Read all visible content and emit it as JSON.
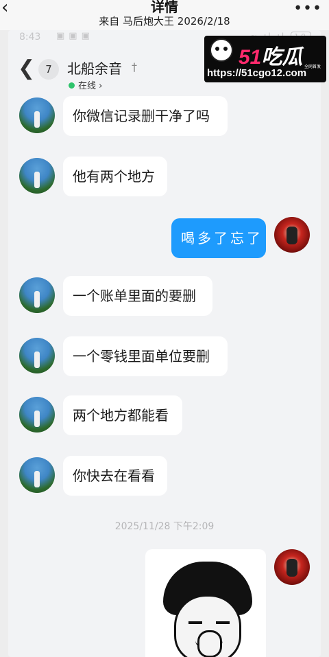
{
  "outer": {
    "back_icon": "chevron-left-icon",
    "title": "详情",
    "subtitle": "来自 马后炮大王 2026/2/18",
    "more_icon": "more-dots-icon"
  },
  "statusbar": {
    "time": "8:43",
    "battery": "10"
  },
  "chat": {
    "unread_count": "7",
    "contact_name": "北船余音",
    "status": "在线 ›"
  },
  "watermark": {
    "brand_num": "51",
    "brand_text": "吃瓜",
    "tag": "全网首发",
    "url": "https://51cgo12.com"
  },
  "messages": [
    {
      "side": "left",
      "text": "你微信记录删干净了吗"
    },
    {
      "side": "left",
      "text": "他有两个地方"
    },
    {
      "side": "right",
      "text": "喝多了忘了"
    },
    {
      "side": "left",
      "text": "一个账单里面的要删"
    },
    {
      "side": "left",
      "text": "一个零钱里面单位要删"
    },
    {
      "side": "left",
      "text": "两个地方都能看"
    },
    {
      "side": "left",
      "text": "你快去在看看"
    }
  ],
  "timestamp": "2025/11/28 下午2:09",
  "colors": {
    "bubble_right": "#1e9bfd",
    "bubble_left": "#ffffff",
    "online": "#2ec36b"
  }
}
